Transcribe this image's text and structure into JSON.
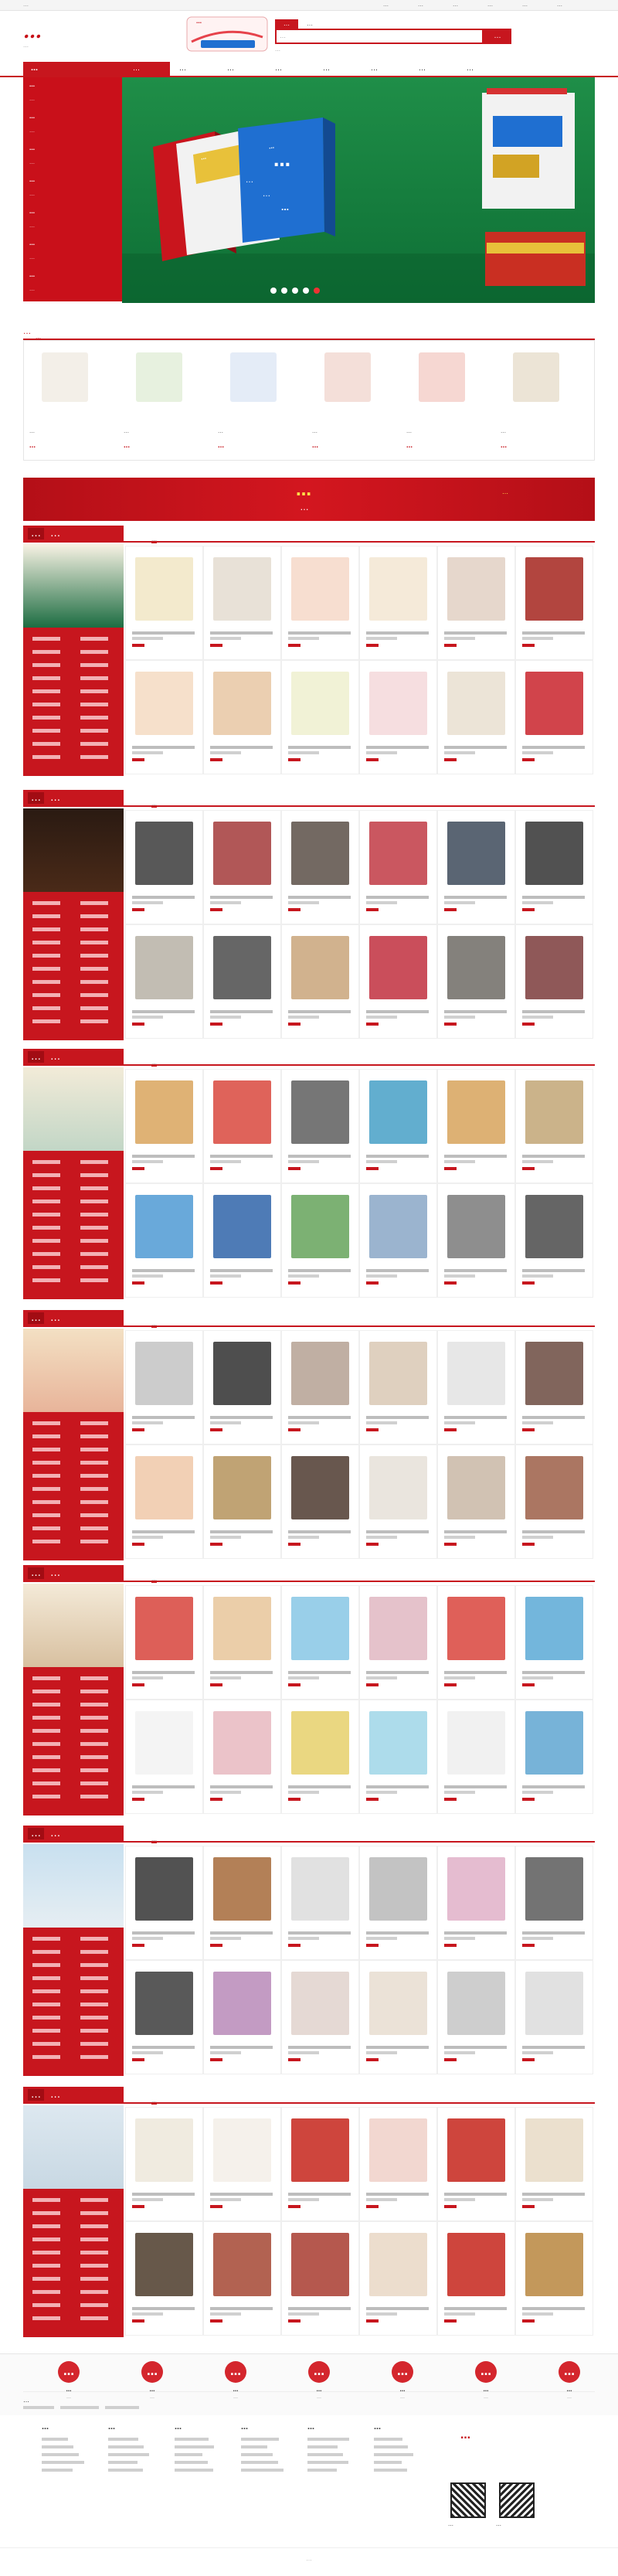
{
  "topbar": {
    "welcome": "…",
    "links": [
      "…",
      "…",
      "…",
      "…",
      "…",
      "…"
    ]
  },
  "header": {
    "logo_text": "…",
    "logo_subtitle": "…",
    "badge_text": "…",
    "search_tabs": [
      "…",
      "…"
    ],
    "search_placeholder": "…",
    "search_button": "…",
    "hot_words": "…"
  },
  "nav": {
    "all_categories": "…",
    "items": [
      "…",
      "…",
      "…",
      "…",
      "…",
      "…",
      "…",
      "…"
    ]
  },
  "category_menu": [
    "…",
    "…",
    "…",
    "…",
    "…",
    "…",
    "…",
    "…",
    "…",
    "…",
    "…",
    "…",
    "…",
    "…"
  ],
  "banner": {
    "title": "…",
    "subtitle_1": "…",
    "subtitle_2": "…",
    "subtitle_3": "…",
    "box_red_label": "…",
    "box_blue_label": "…",
    "dots": 5
  },
  "hot_products": {
    "title": "…",
    "subtitle": "…",
    "items": [
      {
        "name": "…",
        "price": "…"
      },
      {
        "name": "…",
        "price": "…"
      },
      {
        "name": "…",
        "price": "…"
      },
      {
        "name": "…",
        "price": "…"
      },
      {
        "name": "…",
        "price": "…"
      },
      {
        "name": "…",
        "price": "…"
      }
    ]
  },
  "promo_banner": {
    "title": "…",
    "subtitle": "…",
    "cta": "…"
  },
  "floors": [
    {
      "num": "…",
      "name": "…",
      "tab": "…"
    },
    {
      "num": "…",
      "name": "…",
      "tab": "…"
    },
    {
      "num": "…",
      "name": "…",
      "tab": "…"
    },
    {
      "num": "…",
      "name": "…",
      "tab": "…"
    },
    {
      "num": "…",
      "name": "…",
      "tab": "…"
    },
    {
      "num": "…",
      "name": "…",
      "tab": "…"
    },
    {
      "num": "…",
      "name": "…",
      "tab": "…"
    }
  ],
  "services": [
    {
      "icon": "…",
      "title": "…",
      "desc": "…"
    },
    {
      "icon": "…",
      "title": "…",
      "desc": "…"
    },
    {
      "icon": "…",
      "title": "…",
      "desc": "…"
    },
    {
      "icon": "…",
      "title": "…",
      "desc": "…"
    },
    {
      "icon": "…",
      "title": "…",
      "desc": "…"
    },
    {
      "icon": "…",
      "title": "…",
      "desc": "…"
    },
    {
      "icon": "…",
      "title": "…",
      "desc": "…"
    }
  ],
  "friend_links_label": "…",
  "footer_columns": [
    "…",
    "…",
    "…",
    "…",
    "…",
    "…"
  ],
  "hotline": "…",
  "qr_labels": [
    "…",
    "…"
  ],
  "copyright": "…"
}
